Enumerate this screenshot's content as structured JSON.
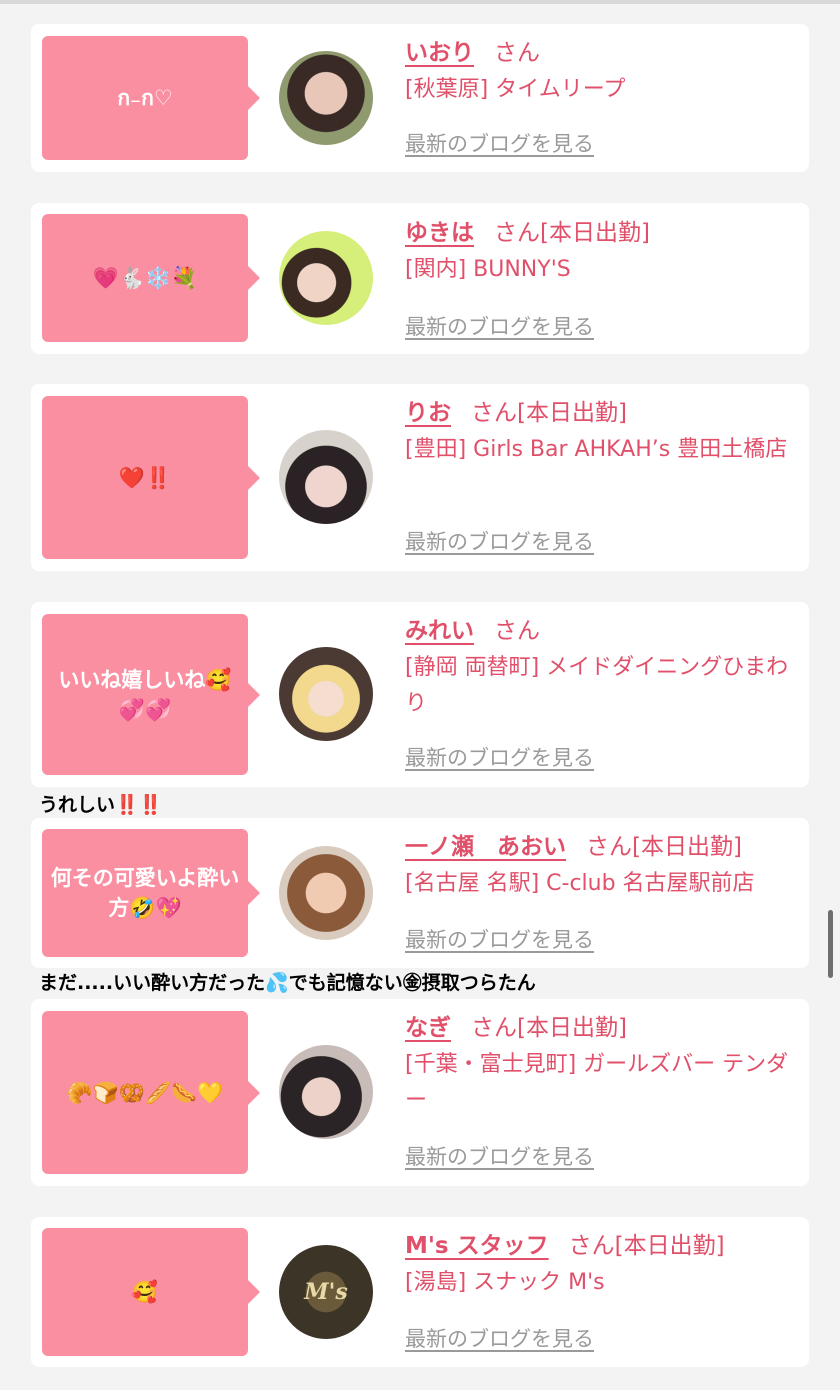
{
  "blog_link_label": "最新のブログを見る",
  "honorific": "さん",
  "cards": [
    {
      "message": "ก₋ก♡",
      "name": "いおり",
      "suffix": "",
      "shop": "[秋葉原] タイムリープ",
      "avatar_colors": [
        "#3a2a26",
        "#e9c7b8"
      ]
    },
    {
      "message": "💗🐇❄️💐",
      "name": "ゆきは",
      "suffix": "[本日出勤]",
      "shop": "[関内] BUNNY'S",
      "avatar_colors": [
        "#d6ef7a",
        "#3a2a22"
      ]
    },
    {
      "message": "❤️‼️",
      "name": "りお",
      "suffix": "[本日出勤]",
      "shop": "[豊田] Girls Bar AHKAH’s 豊田土橋店",
      "avatar_colors": [
        "#2a2224",
        "#f0d5cf"
      ]
    },
    {
      "message": "いいね嬉しいね🥰💞💞",
      "name": "みれい",
      "suffix": "",
      "shop": "[静岡 両替町] メイドダイニングひまわり",
      "avatar_colors": [
        "#f2d98e",
        "#4b3a33"
      ]
    },
    {
      "message": "何その可愛いよ酔い方🤣💖",
      "name": "一ノ瀬　あおい",
      "suffix": "[本日出勤]",
      "shop": "[名古屋 名駅] C-club 名古屋駅前店",
      "avatar_colors": [
        "#8a5a3a",
        "#f1cbb1"
      ]
    },
    {
      "message": "🥐🍞🥨🥖🌭💛",
      "name": "なぎ",
      "suffix": "[本日出勤]",
      "shop": "[千葉・富士見町] ガールズバー テンダー",
      "avatar_colors": [
        "#2b2426",
        "#ecd2c8"
      ]
    },
    {
      "message": "🥰",
      "name": "M's スタッフ",
      "suffix": "[本日出勤]",
      "shop": "[湯島] スナック M's",
      "avatar_colors": [
        "#3b3427",
        "#b79a56"
      ],
      "avatar_logo": "M's"
    }
  ],
  "notes": [
    {
      "text": "うれしい",
      "emoji": "‼️‼️"
    },
    {
      "text": "まだ.....いい酔い方だった💦でも記憶ない㊎摂取つらたん",
      "emoji": ""
    }
  ]
}
